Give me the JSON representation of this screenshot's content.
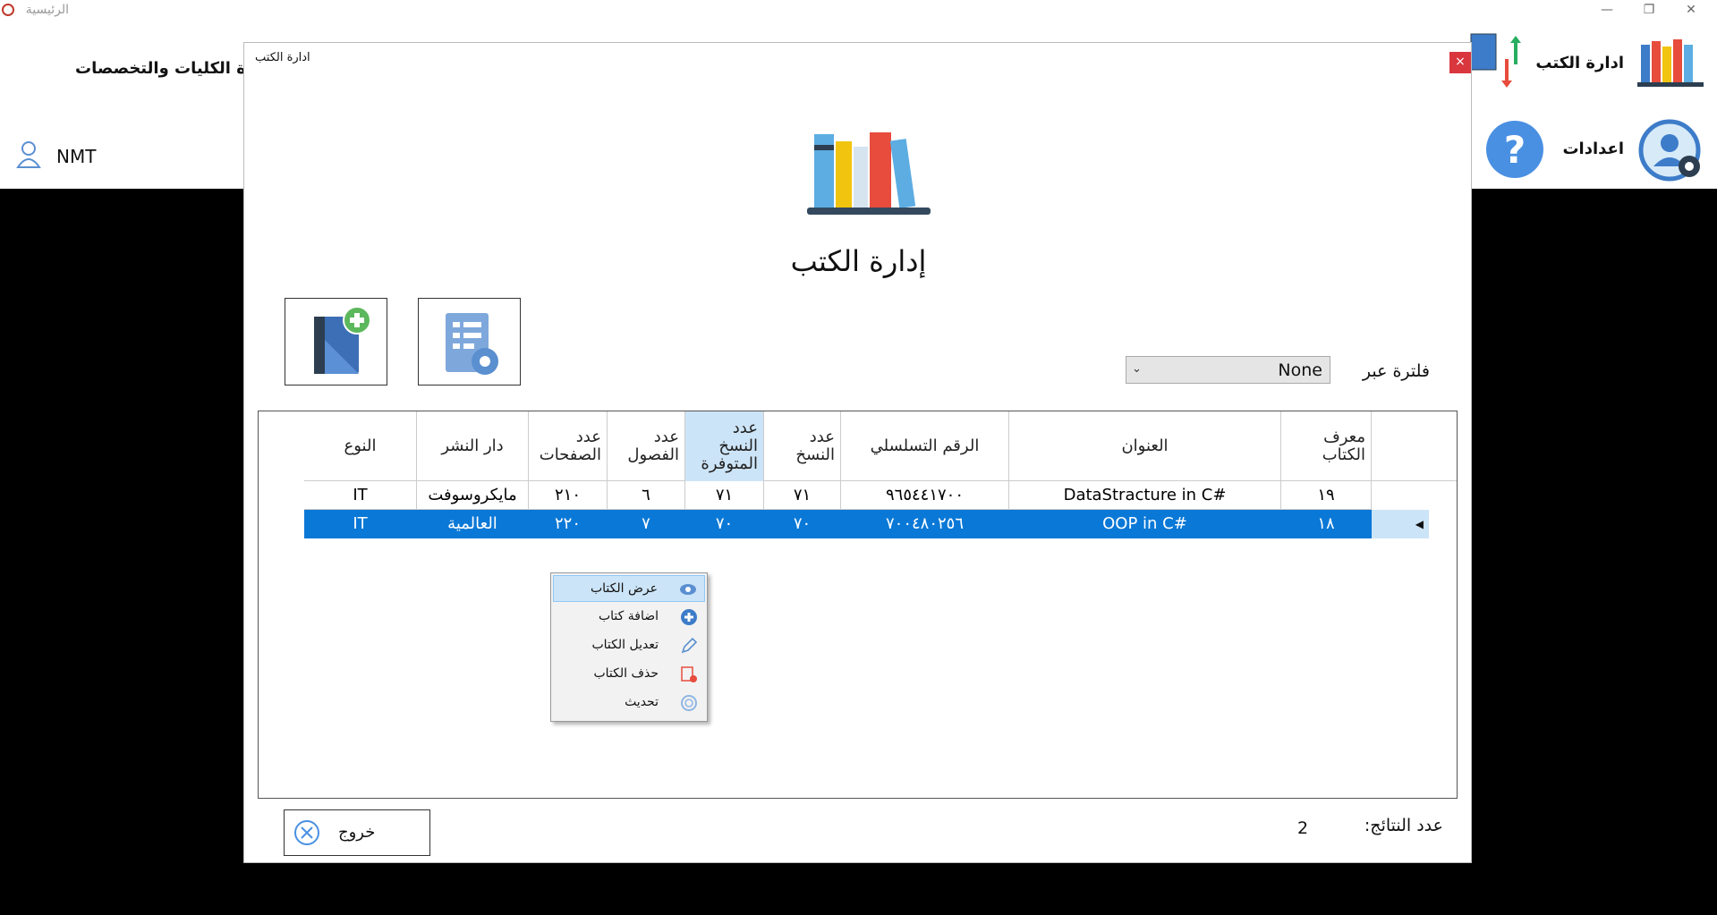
{
  "app": {
    "title": "الرئيسية",
    "user": "NMT"
  },
  "nav": {
    "books": "ادارة الكتب",
    "settings": "اعدادات",
    "colleges": "ادارة الكليات والتخصصات"
  },
  "dialog": {
    "title": "ادارة الكتب",
    "heading": "إدارة الكتب",
    "close": "×",
    "filter_label": "فلترة عبر",
    "filter_value": "None",
    "exit_label": "خروج",
    "count_label": "عدد النتائج:",
    "count_value": "2"
  },
  "grid": {
    "columns": [
      "معرف الكتاب",
      "العنوان",
      "الرقم التسلسلي",
      "عدد النسخ",
      "عدد النسخ المتوفرة",
      "عدد الفصول",
      "عدد الصفحات",
      "دار النشر",
      "النوع"
    ],
    "rows": [
      [
        "١٩",
        "DataStracture in C#",
        "٩٦٥٤٤١٧٠٠",
        "٧١",
        "٧١",
        "٦",
        "٢١٠",
        "مايكروسوفت",
        "IT"
      ],
      [
        "١٨",
        "OOP in C#",
        "٧٠٠٤٨٠٢٥٦",
        "٧٠",
        "٧٠",
        "٧",
        "٢٢٠",
        "العالمية",
        "IT"
      ]
    ],
    "selected_row": 1
  },
  "context_menu": [
    "عرض الكتاب",
    "اضافة كتاب",
    "تعديل الكتاب",
    "حذف الكتاب",
    "تحديث"
  ],
  "colors": {
    "selection": "#0a78d7",
    "close": "#d9363e",
    "sorted_header": "#cce4f7"
  }
}
